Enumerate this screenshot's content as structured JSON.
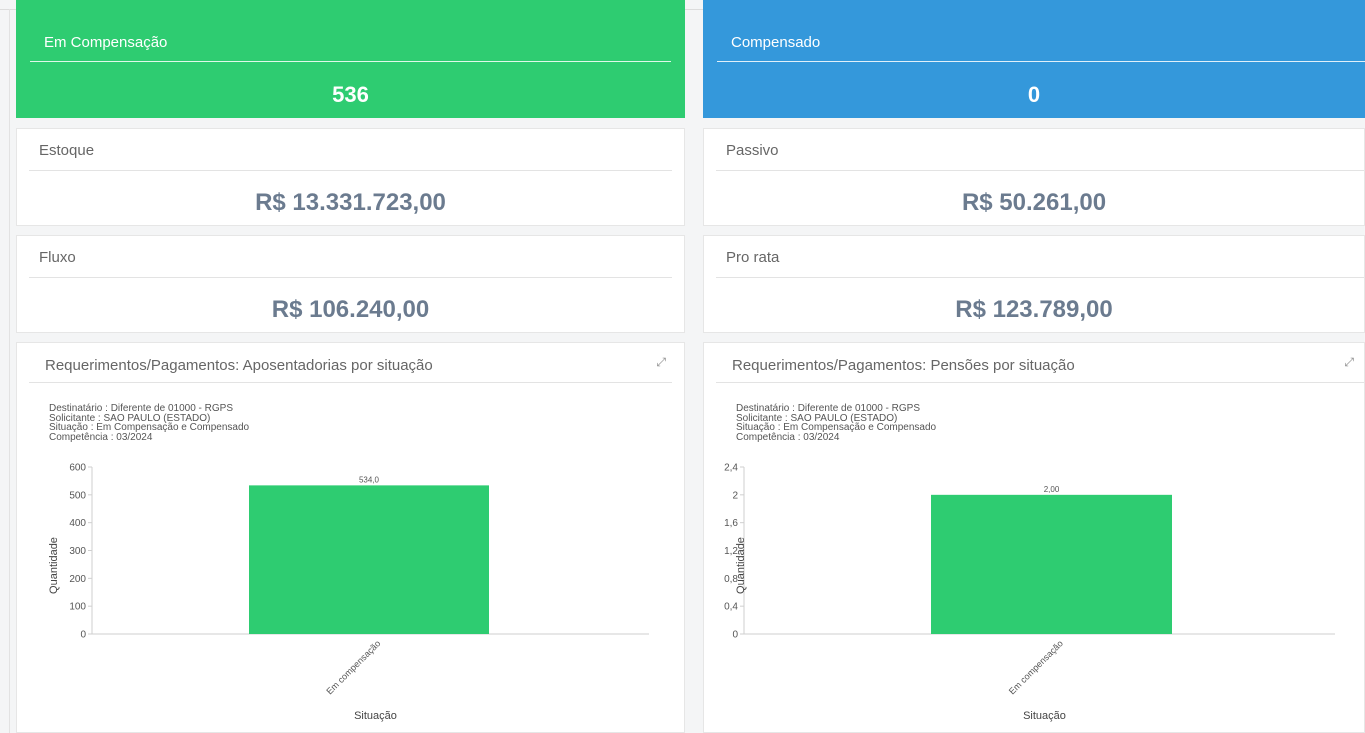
{
  "colors": {
    "green": "#2ecc71",
    "blue": "#3498db",
    "value_gray": "#6b7b8f"
  },
  "stats": {
    "em_compensacao": {
      "label": "Em Compensação",
      "value": "536"
    },
    "compensado": {
      "label": "Compensado",
      "value": "0"
    }
  },
  "values": {
    "estoque": {
      "label": "Estoque",
      "value": "R$ 13.331.723,00"
    },
    "passivo": {
      "label": "Passivo",
      "value": "R$ 50.261,00"
    },
    "fluxo": {
      "label": "Fluxo",
      "value": "R$ 106.240,00"
    },
    "pro_rata": {
      "label": "Pro rata",
      "value": "R$ 123.789,00"
    }
  },
  "charts": {
    "aposentadorias": {
      "title": "Requerimentos/Pagamentos: Aposentadorias por situação",
      "filters": [
        "Destinatário : Diferente de 01000 - RGPS",
        "Solicitante : SAO PAULO (ESTADO)",
        "Situação : Em Compensação e Compensado",
        "Competência : 03/2024"
      ]
    },
    "pensoes": {
      "title": "Requerimentos/Pagamentos: Pensões por situação",
      "filters": [
        "Destinatário : Diferente de 01000 - RGPS",
        "Solicitante : SAO PAULO (ESTADO)",
        "Situação : Em Compensação e Compensado",
        "Competência : 03/2024"
      ]
    }
  },
  "chart_data": [
    {
      "type": "bar",
      "title": "Requerimentos/Pagamentos: Aposentadorias por situação",
      "categories": [
        "Em compensação"
      ],
      "values": [
        534
      ],
      "data_labels": [
        "534,0"
      ],
      "xlabel": "Situação",
      "ylabel": "Quantidade",
      "ylim": [
        0,
        600
      ],
      "yticks": [
        0,
        100,
        200,
        300,
        400,
        500,
        600
      ],
      "ytick_labels": [
        "0",
        "100",
        "200",
        "300",
        "400",
        "500",
        "600"
      ],
      "color": "#2ecc71",
      "grid": false
    },
    {
      "type": "bar",
      "title": "Requerimentos/Pagamentos: Pensões por situação",
      "categories": [
        "Em compensação"
      ],
      "values": [
        2
      ],
      "data_labels": [
        "2,00"
      ],
      "xlabel": "Situação",
      "ylabel": "Quantidade",
      "ylim": [
        0,
        2.4
      ],
      "yticks": [
        0,
        0.4,
        0.8,
        1.2,
        1.6,
        2,
        2.4
      ],
      "ytick_labels": [
        "0",
        "0,4",
        "0,8",
        "1,2",
        "1,6",
        "2",
        "2,4"
      ],
      "color": "#2ecc71",
      "grid": false
    }
  ]
}
